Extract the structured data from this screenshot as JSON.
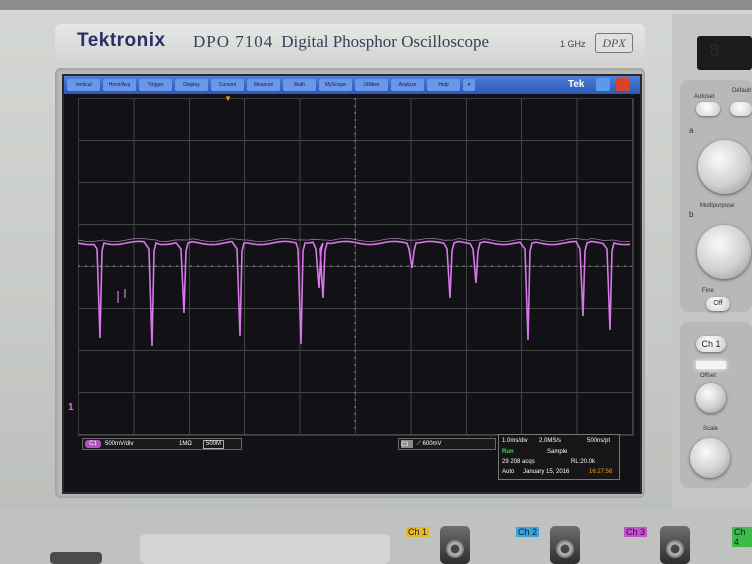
{
  "instrument": {
    "brand": "Tektronix",
    "model_number": "DPO 7104",
    "model_name": "Digital Phosphor Oscilloscope",
    "bandwidth": "1 GHz",
    "badge": "DPX"
  },
  "menubar": {
    "items": [
      "Vertical",
      "Horiz/Acq",
      "Trigger",
      "Display",
      "Cursors",
      "Measure",
      "Math",
      "MyScope",
      "Utilities",
      "Analyze",
      "Help"
    ],
    "brand_label": "Tek"
  },
  "trace": {
    "color": "#d777e8",
    "channel_marker": "1"
  },
  "channel_status": {
    "channel": "C1",
    "scale": "500mV/div",
    "impedance": "1MΩ",
    "bandwidth_limit": "500M"
  },
  "trigger_status": {
    "source": "C1",
    "level": "600mV"
  },
  "acquisition": {
    "timebase": "1.0ms/div",
    "sample_rate": "2.0MS/s",
    "resolution": "500ns/pt",
    "state": "Run",
    "mode": "Sample",
    "acqs": "29 208 acqs",
    "record_length": "RL:20.0k",
    "trigger_mode": "Auto",
    "date": "January 15, 2016",
    "time": "16:27:56"
  },
  "front_panel": {
    "autoset": "Autoset",
    "default": "Default",
    "multipurpose": "Multipurpose",
    "knob_a": "a",
    "knob_b": "b",
    "fine": "Fine",
    "off": "Off",
    "ch1_button": "Ch 1",
    "offset": "Offset",
    "scale": "Scale"
  },
  "inputs": {
    "labels": [
      "Ch 1",
      "Ch 2",
      "Ch 3",
      "Ch 4"
    ],
    "colors": [
      "#e3b82a",
      "#3aa3e0",
      "#c84fcf",
      "#3dbb4a"
    ]
  }
}
